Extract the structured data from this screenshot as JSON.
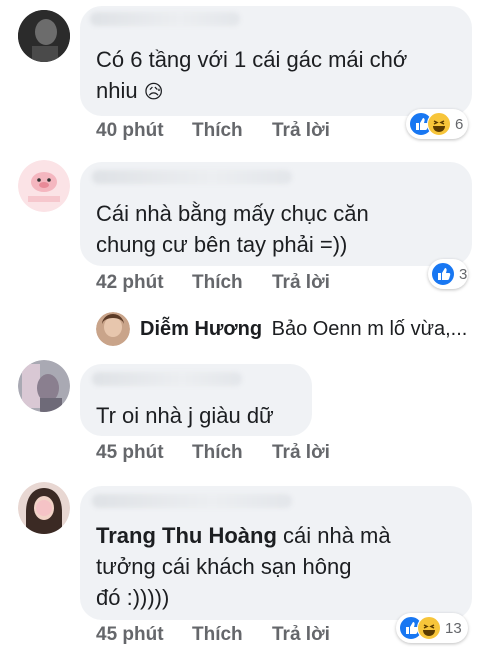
{
  "comments": [
    {
      "text": "Có 6 tầng với 1 cái gác mái chớ nhiu 😥",
      "line1": "Có 6 tầng với 1 cái gác mái chớ",
      "line2": "nhiu",
      "emoji": "😥",
      "time": "40 phút",
      "like": "Thích",
      "reply": "Trả lời",
      "reaction_count": "6",
      "reactions": [
        "like-icon",
        "haha-icon"
      ]
    },
    {
      "line1": "Cái nhà bằng mấy chục căn",
      "line2": "chung cư bên tay phải =))",
      "time": "42 phút",
      "like": "Thích",
      "reply": "Trả lời",
      "reaction_count": "3",
      "reactions": [
        "like-icon"
      ]
    },
    {
      "line1": "Tr oi nhà j giàu dữ",
      "time": "45 phút",
      "like": "Thích",
      "reply": "Trả lời"
    },
    {
      "mention": "Trang Thu Hoàng",
      "line1_rest": " cái nhà mà",
      "line2": "tưởng cái khách sạn hông",
      "line3": "đó :)))))",
      "time": "45 phút",
      "like": "Thích",
      "reply": "Trả lời",
      "reaction_count": "13",
      "reactions": [
        "like-icon",
        "haha-icon"
      ]
    }
  ],
  "reply_preview": {
    "author": "Diễm Hương",
    "text": "Bảo Oenn m lố vừa,..."
  },
  "colors": {
    "bubble": "#f0f2f5",
    "meta": "#65676b",
    "like": "#1877f2",
    "haha": "#f7c53a"
  }
}
